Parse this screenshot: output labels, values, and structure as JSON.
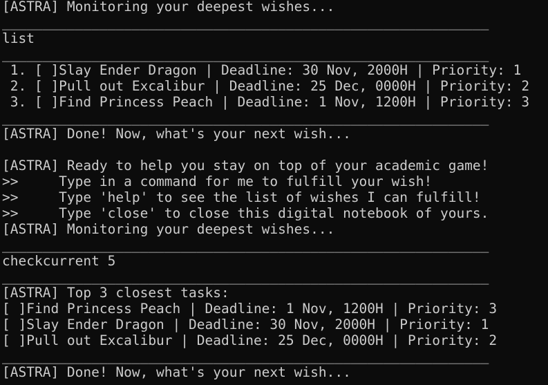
{
  "terminal": {
    "lines": [
      "[ASTRA] Monitoring your deepest wishes...",
      "____________________________________________________________",
      "list",
      "____________________________________________________________",
      " 1. [ ]Slay Ender Dragon | Deadline: 30 Nov, 2000H | Priority: 1",
      " 2. [ ]Pull out Excalibur | Deadline: 25 Dec, 0000H | Priority: 2",
      " 3. [ ]Find Princess Peach | Deadline: 1 Nov, 1200H | Priority: 3",
      "____________________________________________________________",
      "[ASTRA] Done! Now, what's your next wish...",
      "",
      "[ASTRA] Ready to help you stay on top of your academic game!",
      ">>     Type in a command for me to fulfill your wish!",
      ">>     Type 'help' to see the list of wishes I can fulfill!",
      ">>     Type 'close' to close this digital notebook of yours.",
      "[ASTRA] Monitoring your deepest wishes...",
      "____________________________________________________________",
      "checkcurrent 5",
      "____________________________________________________________",
      "[ASTRA] Top 3 closest tasks:",
      "[ ]Find Princess Peach | Deadline: 1 Nov, 1200H | Priority: 3",
      "[ ]Slay Ender Dragon | Deadline: 30 Nov, 2000H | Priority: 1",
      "[ ]Pull out Excalibur | Deadline: 25 Dec, 0000H | Priority: 2",
      "____________________________________________________________",
      "[ASTRA] Done! Now, what's your next wish..."
    ]
  },
  "colors": {
    "background": "#0c0c0c",
    "foreground": "#cccccc"
  }
}
